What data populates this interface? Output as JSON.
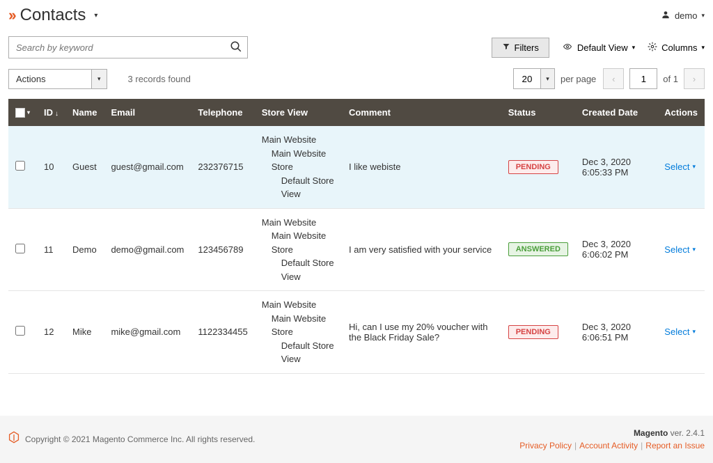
{
  "header": {
    "title": "Contacts",
    "user_label": "demo"
  },
  "search": {
    "placeholder": "Search by keyword"
  },
  "toolbar": {
    "filters_label": "Filters",
    "default_view_label": "Default View",
    "columns_label": "Columns",
    "actions_label": "Actions",
    "records_found": "3 records found",
    "per_page_value": "20",
    "per_page_label": "per page",
    "page_current": "1",
    "page_of_label": "of",
    "page_total": "1"
  },
  "columns": {
    "id": "ID",
    "name": "Name",
    "email": "Email",
    "telephone": "Telephone",
    "store_view": "Store View",
    "comment": "Comment",
    "status": "Status",
    "created_date": "Created Date",
    "actions": "Actions"
  },
  "store_lines": {
    "l1": "Main Website",
    "l2": "Main Website Store",
    "l3": "Default Store View"
  },
  "rows": [
    {
      "id": "10",
      "name": "Guest",
      "email": "guest@gmail.com",
      "telephone": "232376715",
      "comment": "I like webiste",
      "status": "PENDING",
      "status_class": "pending",
      "created": "Dec 3, 2020 6:05:33 PM",
      "action": "Select"
    },
    {
      "id": "11",
      "name": "Demo",
      "email": "demo@gmail.com",
      "telephone": "123456789",
      "comment": "I am very satisfied with your service",
      "status": "ANSWERED",
      "status_class": "answered",
      "created": "Dec 3, 2020 6:06:02 PM",
      "action": "Select"
    },
    {
      "id": "12",
      "name": "Mike",
      "email": "mike@gmail.com",
      "telephone": "1122334455",
      "comment": "Hi, can I use my 20% voucher with the Black Friday Sale?",
      "status": "PENDING",
      "status_class": "pending",
      "created": "Dec 3, 2020 6:06:51 PM",
      "action": "Select"
    }
  ],
  "footer": {
    "copyright": "Copyright © 2021 Magento Commerce Inc. All rights reserved.",
    "version_label": "Magento",
    "version_value": "ver. 2.4.1",
    "privacy": "Privacy Policy",
    "activity": "Account Activity",
    "report": "Report an Issue"
  }
}
